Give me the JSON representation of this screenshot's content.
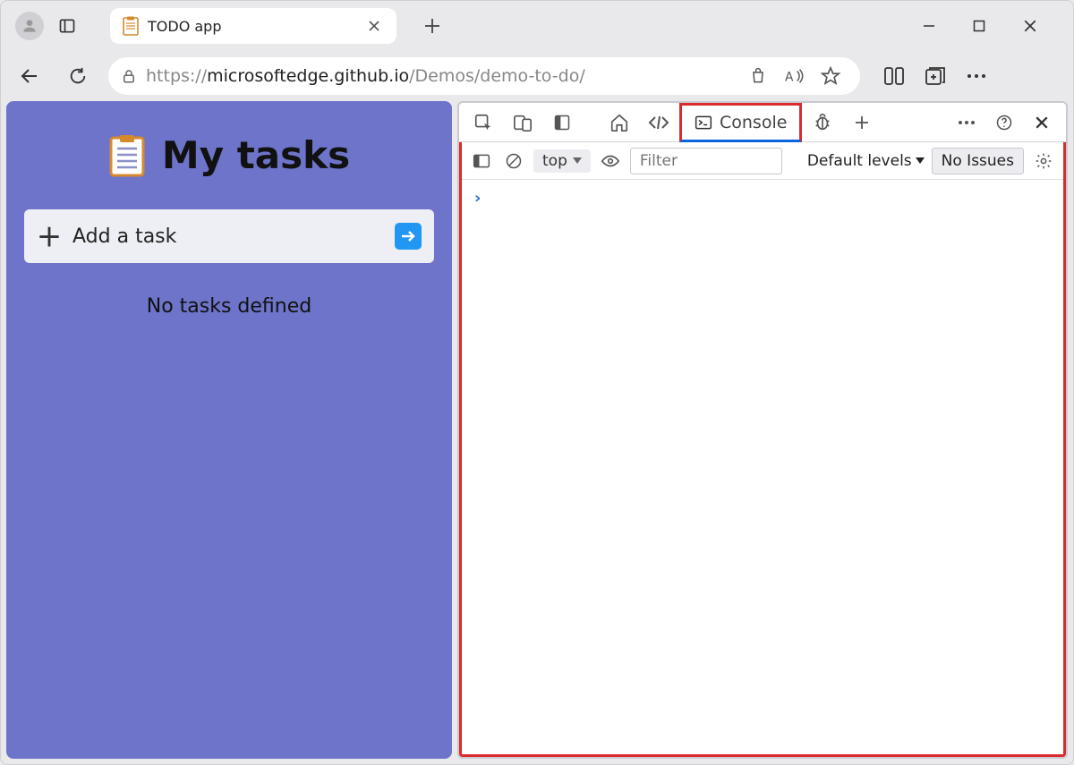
{
  "browser": {
    "tab_title": "TODO app",
    "url_prefix": "https://",
    "url_host": "microsoftedge.github.io",
    "url_path": "/Demos/demo-to-do/"
  },
  "page": {
    "title": "My tasks",
    "add_task_placeholder": "Add a task",
    "empty_message": "No tasks defined"
  },
  "devtools": {
    "tabs": {
      "console": "Console"
    },
    "console": {
      "context": "top",
      "filter_placeholder": "Filter",
      "levels_label": "Default levels",
      "issues_label": "No Issues"
    }
  }
}
